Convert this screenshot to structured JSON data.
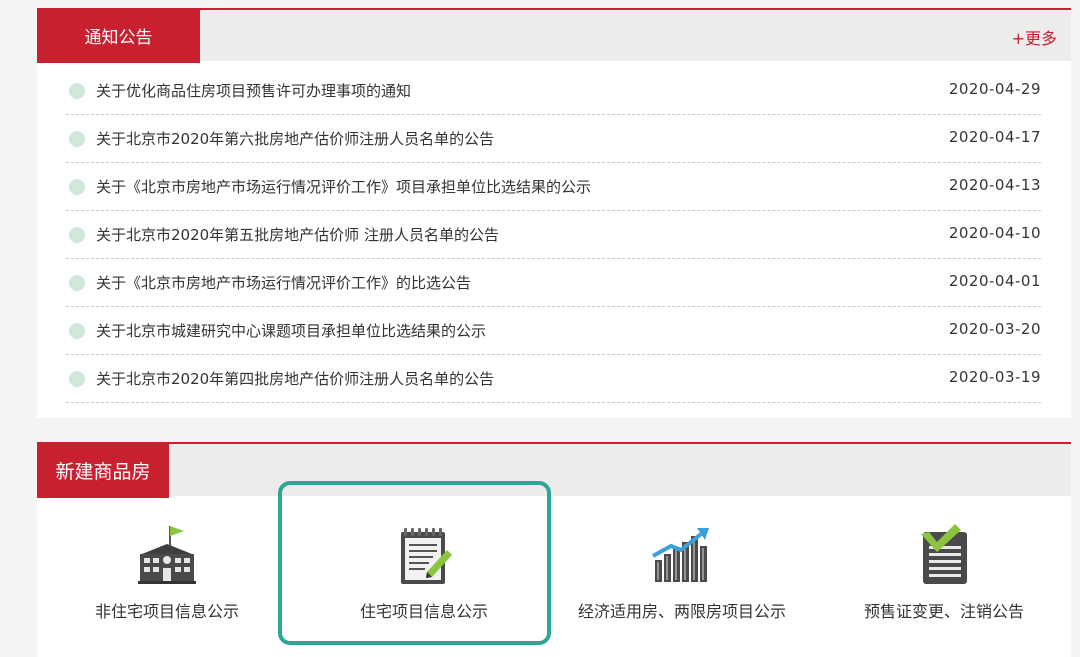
{
  "notices": {
    "header_label": "通知公告",
    "more_label": "+更多",
    "items": [
      {
        "title": "关于优化商品住房项目预售许可办理事项的通知",
        "date": "2020-04-29"
      },
      {
        "title": "关于北京市2020年第六批房地产估价师注册人员名单的公告",
        "date": "2020-04-17"
      },
      {
        "title": "关于《北京市房地产市场运行情况评价工作》项目承担单位比选结果的公示",
        "date": "2020-04-13"
      },
      {
        "title": "关于北京市2020年第五批房地产估价师 注册人员名单的公告",
        "date": "2020-04-10"
      },
      {
        "title": "关于《北京市房地产市场运行情况评价工作》的比选公告",
        "date": "2020-04-01"
      },
      {
        "title": "关于北京市城建研究中心课题项目承担单位比选结果的公示",
        "date": "2020-03-20"
      },
      {
        "title": "关于北京市2020年第四批房地产估价师注册人员名单的公告",
        "date": "2020-03-19"
      }
    ]
  },
  "housing": {
    "header_label": "新建商品房",
    "items": [
      {
        "label": "非住宅项目信息公示",
        "icon": "building-flag-icon"
      },
      {
        "label": "住宅项目信息公示",
        "icon": "notepad-pencil-icon"
      },
      {
        "label": "经济适用房、两限房项目公示",
        "icon": "bar-chart-arrow-icon"
      },
      {
        "label": "预售证变更、注销公告",
        "icon": "document-check-icon"
      }
    ]
  },
  "colors": {
    "brand_red": "#c8202f",
    "highlight_teal": "#2aa895",
    "bullet_green": "#cfe8d9",
    "icon_green": "#8cc43f"
  }
}
